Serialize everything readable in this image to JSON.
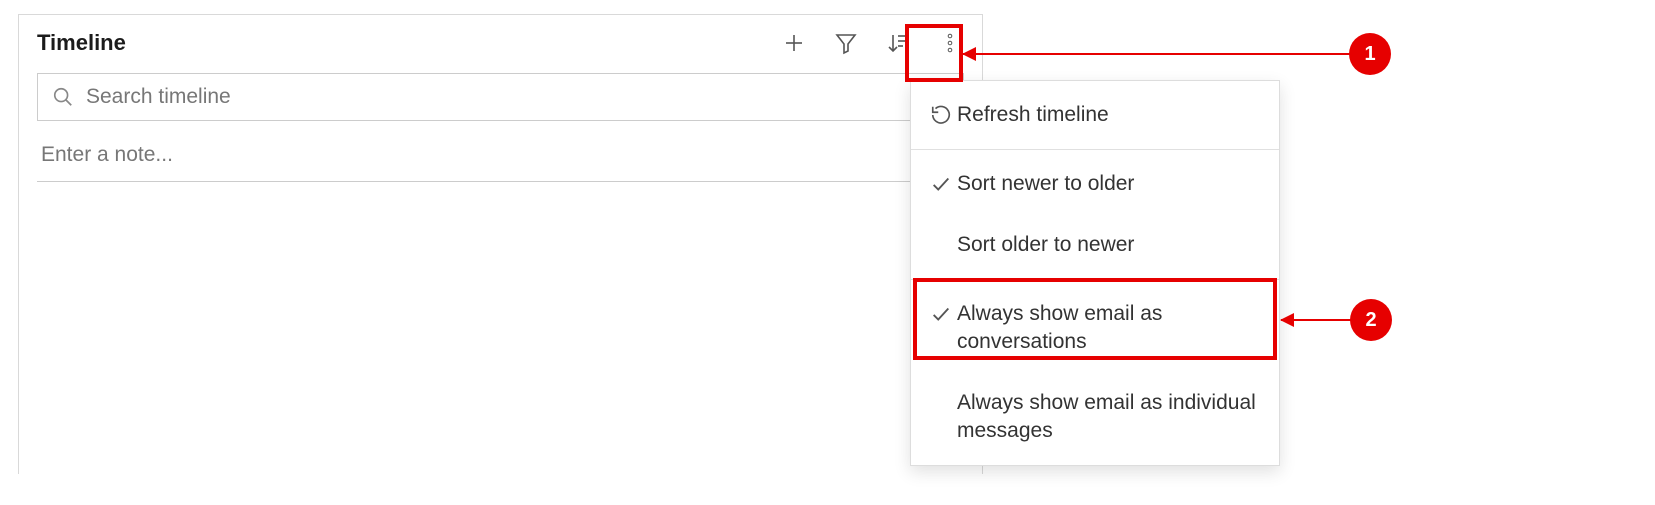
{
  "timeline": {
    "title": "Timeline",
    "search_placeholder": "Search timeline",
    "note_placeholder": "Enter a note..."
  },
  "menu": {
    "refresh": "Refresh timeline",
    "sort_newer": "Sort newer to older",
    "sort_older": "Sort older to newer",
    "email_conversations": "Always show email as conversations",
    "email_individual": "Always show email as individual messages"
  },
  "callouts": {
    "one": "1",
    "two": "2"
  }
}
